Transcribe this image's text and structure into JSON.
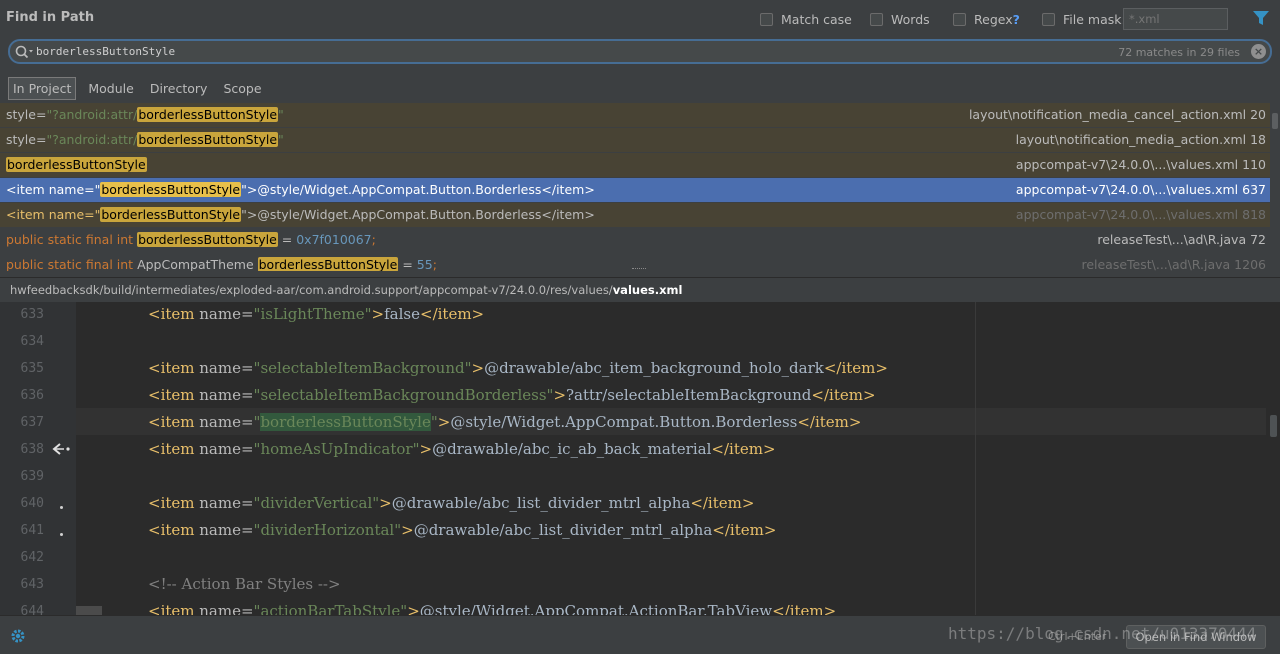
{
  "title": "Find in Path",
  "options": {
    "match_case": "Match case",
    "words": "Words",
    "regex": "Regex",
    "regex_help": "?",
    "file_mask": "File mask:",
    "file_mask_placeholder": "*.xml"
  },
  "search": {
    "query": "borderlessButtonStyle",
    "match_count": "72 matches in 29 files"
  },
  "scope_tabs": [
    "In Project",
    "Module",
    "Directory",
    "Scope"
  ],
  "results": [
    {
      "pre": "style=",
      "q1": "\"?android:attr/",
      "hit": "borderlessButtonStyle",
      "q2": "\"",
      "post": "",
      "file": "layout\\notification_media_cancel_action.xml 20"
    },
    {
      "pre": "style=",
      "q1": "\"?android:attr/",
      "hit": "borderlessButtonStyle",
      "q2": "\"",
      "post": "",
      "file": "layout\\notification_media_action.xml 18"
    },
    {
      "pre": "",
      "q1": "",
      "hit": "borderlessButtonStyle",
      "q2": "",
      "post": "",
      "file": "appcompat-v7\\24.0.0\\...\\values.xml 110"
    },
    {
      "pre": "<item name=",
      "q1": "\"",
      "hit": "borderlessButtonStyle",
      "q2": "\"",
      "post": ">@style/Widget.AppCompat.Button.Borderless</item>",
      "file": "appcompat-v7\\24.0.0\\...\\values.xml 637"
    },
    {
      "pre": "<item name=",
      "q1": "\"",
      "hit": "borderlessButtonStyle",
      "q2": "\"",
      "post": ">@style/Widget.AppCompat.Button.Borderless</item>",
      "file": "appcompat-v7\\24.0.0\\...\\values.xml 818"
    },
    {
      "kw": "public static final int ",
      "hit": "borderlessButtonStyle",
      "post_eq": " = ",
      "post_num": "0x7f010067",
      "post_end": ";",
      "file": "releaseTest\\...\\ad\\R.java 72"
    },
    {
      "kw": "public static final int ",
      "mid": "AppCompatTheme ",
      "hit": "borderlessButtonStyle",
      "post_eq": " = ",
      "post_num": "55",
      "post_end": ";",
      "file": "releaseTest\\...\\ad\\R.java 1206"
    }
  ],
  "path": {
    "dir": "hwfeedbacksdk/build/intermediates/exploded-aar/com.android.support/appcompat-v7/24.0.0/res/values/",
    "file": "values.xml"
  },
  "editor": {
    "line_numbers": [
      "633",
      "634",
      "635",
      "636",
      "637",
      "638",
      "639",
      "640",
      "641",
      "642",
      "643",
      "644"
    ],
    "lines": [
      {
        "open": "<item ",
        "attr": "name=",
        "val": "\"isLightTheme\"",
        "close": ">",
        "text": "false",
        "end": "</item>"
      },
      {},
      {
        "open": "<item ",
        "attr": "name=",
        "val": "\"selectableItemBackground\"",
        "close": ">",
        "text": "@drawable/abc_item_background_holo_dark",
        "end": "</item>"
      },
      {
        "open": "<item ",
        "attr": "name=",
        "val": "\"selectableItemBackgroundBorderless\"",
        "close": ">",
        "text": "?attr/selectableItemBackground",
        "end": "</item>"
      },
      {
        "open": "<item ",
        "attr": "name=",
        "q1": "\"",
        "hit": "borderlessButtonStyle",
        "q2": "\"",
        "close": ">",
        "text": "@style/Widget.AppCompat.Button.Borderless",
        "end": "</item>"
      },
      {
        "open": "<item ",
        "attr": "name=",
        "val": "\"homeAsUpIndicator\"",
        "close": ">",
        "text": "@drawable/abc_ic_ab_back_material",
        "end": "</item>"
      },
      {},
      {
        "open": "<item ",
        "attr": "name=",
        "val": "\"dividerVertical\"",
        "close": ">",
        "text": "@drawable/abc_list_divider_mtrl_alpha",
        "end": "</item>"
      },
      {
        "open": "<item ",
        "attr": "name=",
        "val": "\"dividerHorizontal\"",
        "close": ">",
        "text": "@drawable/abc_list_divider_mtrl_alpha",
        "end": "</item>"
      },
      {},
      {
        "comment": "<!-- Action Bar Styles -->"
      },
      {
        "open": "<item ",
        "attr": "name=",
        "val": "\"actionBarTabStyle\"",
        "close": ">",
        "text": "@style/Widget.AppCompat.ActionBar.TabView",
        "end": "</item>"
      }
    ]
  },
  "footer": {
    "shortcut": "Ctrl+Enter",
    "open_button": "Open in Find Window",
    "watermark": "https://blog.csdn.net/u013370444"
  },
  "colors": {
    "accent": "#4b6eaf",
    "highlight": "#c9a53c",
    "focus_border": "#466d94"
  }
}
